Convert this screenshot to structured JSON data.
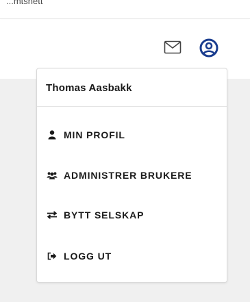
{
  "topbar": {
    "label": "...mtsnett"
  },
  "header": {
    "icons": {
      "mail": "envelope-icon",
      "user": "user-circle-icon"
    }
  },
  "user_menu": {
    "user_name": "Thomas Aasbakk",
    "items": [
      {
        "label": "MIN PROFIL",
        "icon": "user-icon"
      },
      {
        "label": "ADMINISTRER BRUKERE",
        "icon": "users-icon"
      },
      {
        "label": "BYTT SELSKAP",
        "icon": "exchange-icon"
      },
      {
        "label": "LOGG UT",
        "icon": "sign-out-icon"
      }
    ]
  },
  "colors": {
    "accent": "#1a3d8f",
    "text": "#1a1a1a",
    "page_background": "#f0f0f0"
  }
}
